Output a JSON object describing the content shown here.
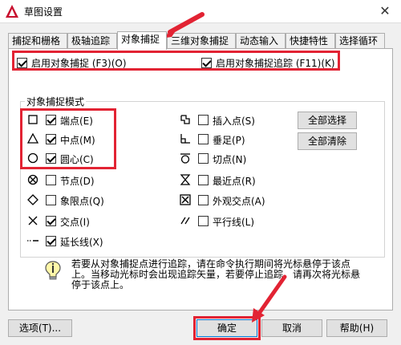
{
  "window": {
    "title": "草图设置",
    "close_glyph": "✕"
  },
  "tabs": [
    {
      "label": "捕捉和栅格"
    },
    {
      "label": "极轴追踪"
    },
    {
      "label": "对象捕捉"
    },
    {
      "label": "三维对象捕捉"
    },
    {
      "label": "动态输入"
    },
    {
      "label": "快捷特性"
    },
    {
      "label": "选择循环"
    }
  ],
  "options": {
    "enable_osnap": {
      "label": "启用对象捕捉 (F3)(O)",
      "checked": true
    },
    "enable_tracking": {
      "label": "启用对象捕捉追踪 (F11)(K)",
      "checked": true
    }
  },
  "group": {
    "title": "对象捕捉模式"
  },
  "snaps_left": [
    {
      "label": "端点(E)",
      "icon": "square-icon",
      "checked": true
    },
    {
      "label": "中点(M)",
      "icon": "triangle-icon",
      "checked": true
    },
    {
      "label": "圆心(C)",
      "icon": "circle-icon",
      "checked": true
    },
    {
      "label": "节点(D)",
      "icon": "node-icon",
      "checked": false
    },
    {
      "label": "象限点(Q)",
      "icon": "diamond-icon",
      "checked": false
    },
    {
      "label": "交点(I)",
      "icon": "x-icon",
      "checked": true
    },
    {
      "label": "延长线(X)",
      "icon": "extension-icon",
      "checked": true
    }
  ],
  "snaps_right": [
    {
      "label": "插入点(S)",
      "icon": "insert-icon",
      "checked": false
    },
    {
      "label": "垂足(P)",
      "icon": "perpendicular-icon",
      "checked": false
    },
    {
      "label": "切点(N)",
      "icon": "tangent-icon",
      "checked": false
    },
    {
      "label": "最近点(R)",
      "icon": "hourglass-icon",
      "checked": false
    },
    {
      "label": "外观交点(A)",
      "icon": "boxed-x-icon",
      "checked": false
    },
    {
      "label": "平行线(L)",
      "icon": "parallel-icon",
      "checked": false
    }
  ],
  "buttons": {
    "select_all": "全部选择",
    "clear_all": "全部清除",
    "options": "选项(T)...",
    "ok": "确定",
    "cancel": "取消",
    "help": "帮助(H)"
  },
  "info": {
    "text": "若要从对象捕捉点进行追踪，请在命令执行期间将光标悬停于该点上。当移动光标时会出现追踪矢量，若要停止追踪，请再次将光标悬停于该点上。"
  },
  "colors": {
    "annotation_red": "#e22333",
    "dialog_bg": "#f0f0f0",
    "default_button_border": "#0078d7"
  }
}
